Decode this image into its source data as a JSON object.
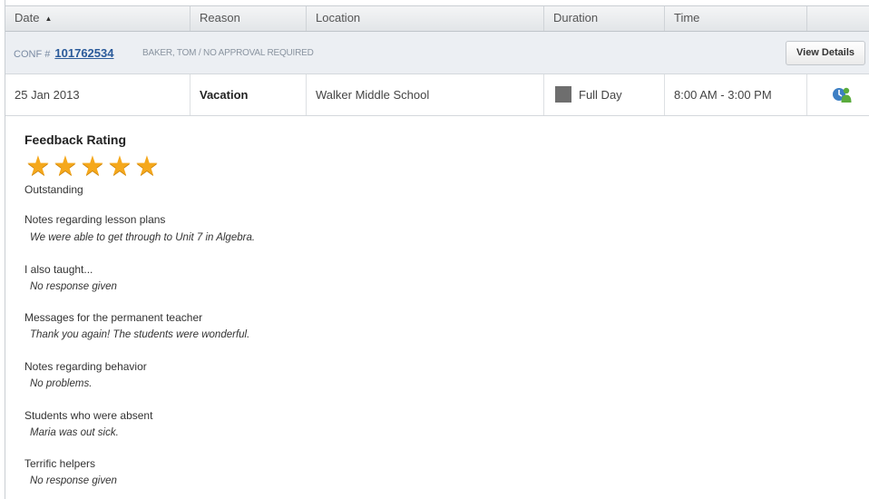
{
  "columns": [
    "Date",
    "Reason",
    "Location",
    "Duration",
    "Time"
  ],
  "conf": {
    "prefix": "CONF #",
    "number": "101762534",
    "detail": "BAKER, TOM / NO APPROVAL REQUIRED",
    "view_details": "View Details"
  },
  "row": {
    "date": "25 Jan 2013",
    "reason": "Vacation",
    "location": "Walker Middle School",
    "duration": "Full Day",
    "time": "8:00 AM - 3:00 PM",
    "duration_color": "#6e6e6e",
    "status_icon": "user-approved-icon"
  },
  "feedback": {
    "title": "Feedback Rating",
    "rating": 5,
    "rating_max": 5,
    "rating_label": "Outstanding",
    "items": [
      {
        "question": "Notes regarding lesson plans",
        "answer": "We were able to get through to Unit 7 in Algebra."
      },
      {
        "question": "I also taught...",
        "answer": "No response given"
      },
      {
        "question": "Messages for the permanent teacher",
        "answer": "Thank you again! The students were wonderful."
      },
      {
        "question": "Notes regarding behavior",
        "answer": "No problems."
      },
      {
        "question": "Students who were absent",
        "answer": "Maria was out sick."
      },
      {
        "question": "Terrific helpers",
        "answer": "No response given"
      }
    ]
  },
  "colors": {
    "star": "#f5a81c",
    "link": "#2a5a9a",
    "conf_bg": "#eceff3"
  }
}
